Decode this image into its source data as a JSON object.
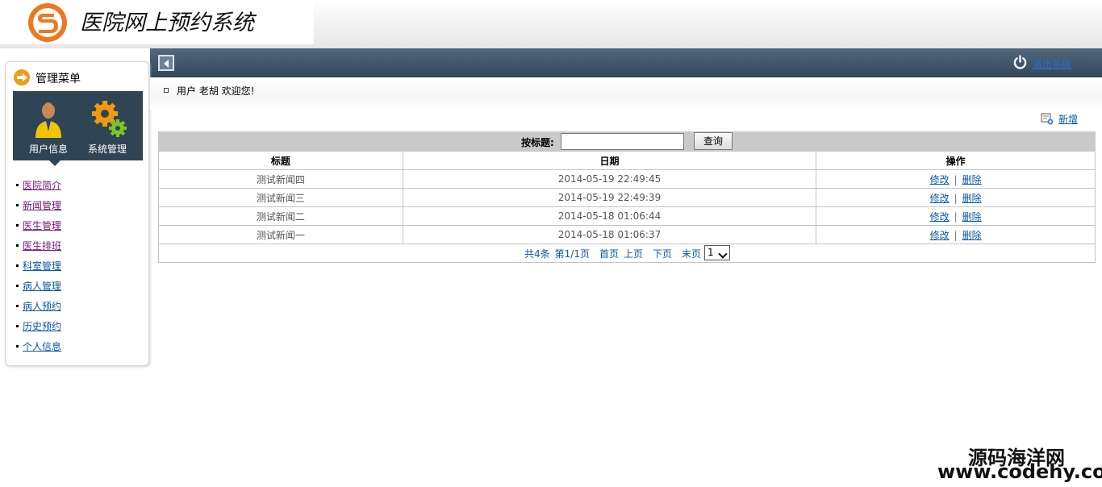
{
  "header": {
    "system_title": "医院网上预约系统",
    "logout_label": "退出系统"
  },
  "sidebar": {
    "title": "管理菜单",
    "tiles": [
      {
        "label": "用户信息",
        "icon": "user-icon"
      },
      {
        "label": "系统管理",
        "icon": "gears-icon"
      }
    ],
    "items": [
      {
        "label": "医院简介",
        "visited": true
      },
      {
        "label": "新闻管理",
        "visited": true
      },
      {
        "label": "医生管理",
        "visited": true
      },
      {
        "label": "医生排班",
        "visited": true
      },
      {
        "label": "科室管理",
        "visited": false
      },
      {
        "label": "病人管理",
        "visited": false
      },
      {
        "label": "病人预约",
        "visited": false
      },
      {
        "label": "历史预约",
        "visited": false
      },
      {
        "label": "个人信息",
        "visited": false
      }
    ]
  },
  "welcome": {
    "text": "用户 老胡 欢迎您!"
  },
  "toolbar": {
    "add_label": "新增"
  },
  "search": {
    "label": "按标题:",
    "value": "",
    "button_label": "查询"
  },
  "table": {
    "headers": [
      "标题",
      "日期",
      "操作"
    ],
    "rows": [
      {
        "title": "测试新闻四",
        "date": "2014-05-19 22:49:45"
      },
      {
        "title": "测试新闻三",
        "date": "2014-05-19 22:49:39"
      },
      {
        "title": "测试新闻二",
        "date": "2014-05-18 01:06:44"
      },
      {
        "title": "测试新闻一",
        "date": "2014-05-18 01:06:37"
      }
    ],
    "edit_label": "修改",
    "delete_label": "删除",
    "separator": "|"
  },
  "pager": {
    "total": "共4条",
    "page_info": "第1/1页",
    "first": "首页",
    "prev": "上页",
    "next": "下页",
    "last": "末页",
    "selected_page": "1"
  },
  "watermark": {
    "line1": "源码海洋网",
    "line2": "www.codehy.com"
  },
  "colors": {
    "navbar": "#3d5366",
    "accent_orange": "#f29a1a",
    "link_blue": "#0b57a8",
    "link_visited": "#7a137a"
  }
}
